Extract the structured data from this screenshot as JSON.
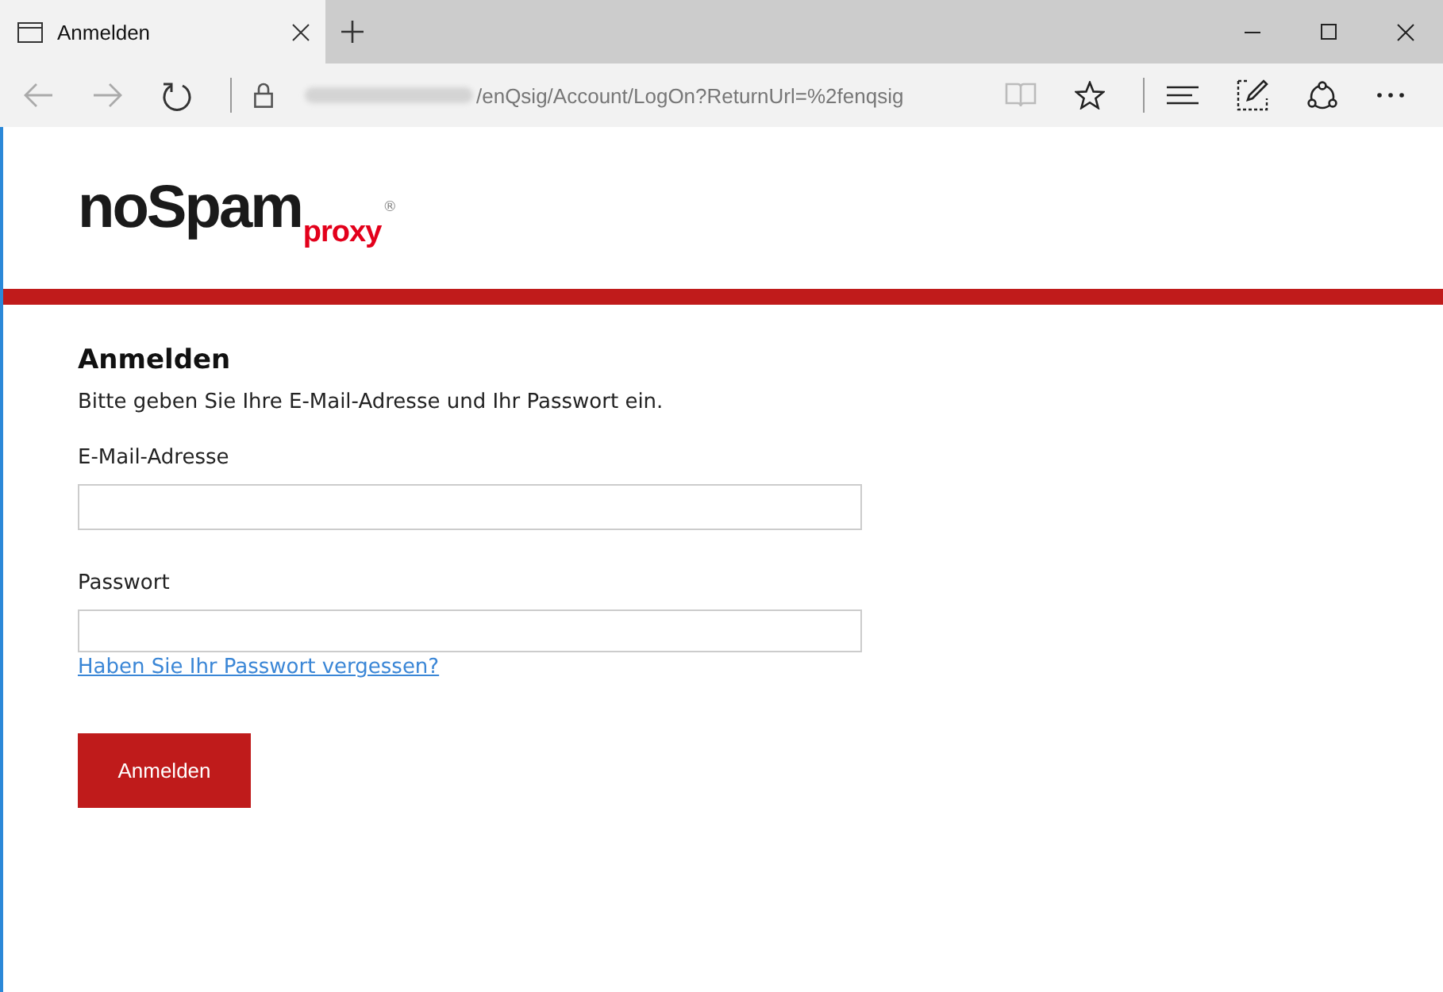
{
  "browser": {
    "tab": {
      "title": "Anmelden",
      "selected": true
    },
    "address": {
      "url": "/enQsig/Account/LogOn?ReturnUrl=%2fenqsig"
    }
  },
  "logo": {
    "main": "noSpam",
    "sub": "proxy",
    "mark": "®"
  },
  "form": {
    "title": "Anmelden",
    "intro": "Bitte geben Sie Ihre E-Mail-Adresse und Ihr Passwort ein.",
    "fields": [
      {
        "label": "E-Mail-Adresse",
        "kind": "text"
      },
      {
        "label": "Passwort",
        "kind": "password"
      }
    ],
    "forgot_link": "Haben Sie Ihr Passwort vergessen?",
    "submit": "Anmelden"
  }
}
